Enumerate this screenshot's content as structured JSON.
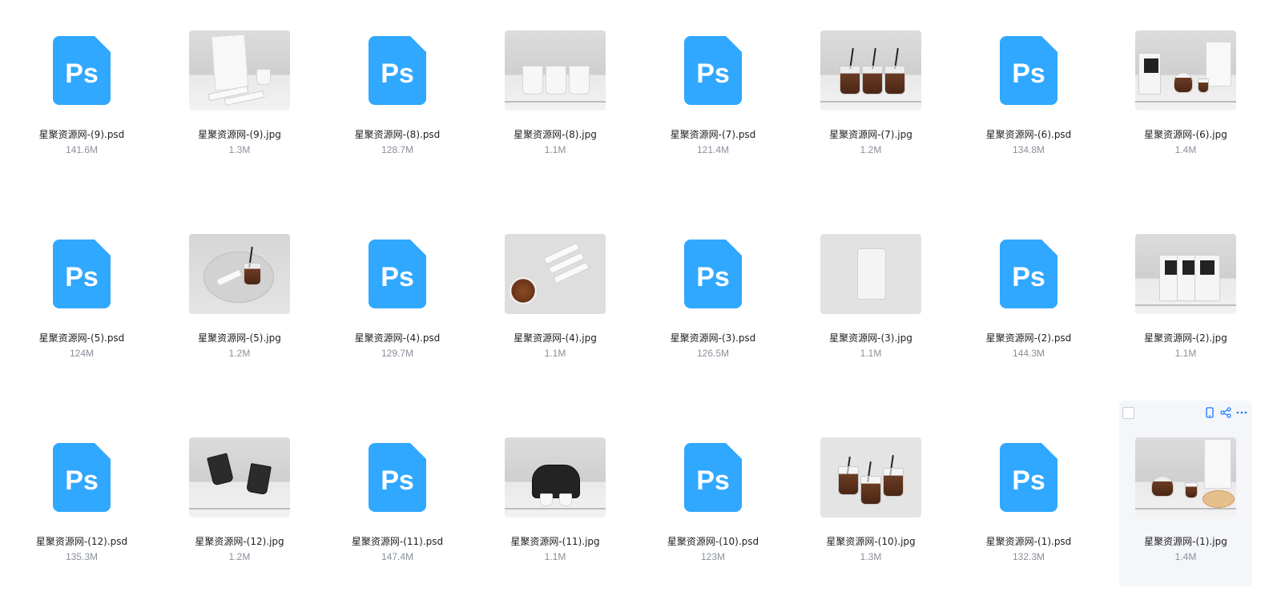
{
  "colors": {
    "ps_icon": "#31a8ff",
    "ps_text": "#ffffff",
    "selected_bg": "#f4f6fa",
    "accent": "#1677ff",
    "size_text": "#8a8f99"
  },
  "files": [
    {
      "name": "星聚资源网-(9).psd",
      "size": "141.6M",
      "kind": "psd",
      "icon": "photoshop-icon"
    },
    {
      "name": "星聚资源网-(9).jpg",
      "size": "1.3M",
      "kind": "jpg",
      "preview": "coffee-card-mockup"
    },
    {
      "name": "星聚资源网-(8).psd",
      "size": "128.7M",
      "kind": "psd",
      "icon": "photoshop-icon"
    },
    {
      "name": "星聚资源网-(8).jpg",
      "size": "1.1M",
      "kind": "jpg",
      "preview": "three-paper-cups"
    },
    {
      "name": "星聚资源网-(7).psd",
      "size": "121.4M",
      "kind": "psd",
      "icon": "photoshop-icon"
    },
    {
      "name": "星聚资源网-(7).jpg",
      "size": "1.2M",
      "kind": "jpg",
      "preview": "three-iced-cups"
    },
    {
      "name": "星聚资源网-(6).psd",
      "size": "134.8M",
      "kind": "psd",
      "icon": "photoshop-icon"
    },
    {
      "name": "星聚资源网-(6).jpg",
      "size": "1.4M",
      "kind": "jpg",
      "preview": "coffee-set-mockup"
    },
    {
      "name": "星聚资源网-(5).psd",
      "size": "124M",
      "kind": "psd",
      "icon": "photoshop-icon"
    },
    {
      "name": "星聚资源网-(5).jpg",
      "size": "1.2M",
      "kind": "jpg",
      "preview": "tray-iced-cup"
    },
    {
      "name": "星聚资源网-(4).psd",
      "size": "129.7M",
      "kind": "psd",
      "icon": "photoshop-icon"
    },
    {
      "name": "星聚资源网-(4).jpg",
      "size": "1.1M",
      "kind": "jpg",
      "preview": "sugar-sticks-cup"
    },
    {
      "name": "星聚资源网-(3).psd",
      "size": "126.5M",
      "kind": "psd",
      "icon": "photoshop-icon"
    },
    {
      "name": "星聚资源网-(3).jpg",
      "size": "1.1M",
      "kind": "jpg",
      "preview": "coffee-pouch"
    },
    {
      "name": "星聚资源网-(2).psd",
      "size": "144.3M",
      "kind": "psd",
      "icon": "photoshop-icon"
    },
    {
      "name": "星聚资源网-(2).jpg",
      "size": "1.1M",
      "kind": "jpg",
      "preview": "three-coffee-bags"
    },
    {
      "name": "星聚资源网-(12).psd",
      "size": "135.3M",
      "kind": "psd",
      "icon": "photoshop-icon"
    },
    {
      "name": "星聚资源网-(12).jpg",
      "size": "1.2M",
      "kind": "jpg",
      "preview": "two-dark-cups"
    },
    {
      "name": "星聚资源网-(11).psd",
      "size": "147.4M",
      "kind": "psd",
      "icon": "photoshop-icon"
    },
    {
      "name": "星聚资源网-(11).jpg",
      "size": "1.1M",
      "kind": "jpg",
      "preview": "cup-carrier"
    },
    {
      "name": "星聚资源网-(10).psd",
      "size": "123M",
      "kind": "psd",
      "icon": "photoshop-icon"
    },
    {
      "name": "星聚资源网-(10).jpg",
      "size": "1.3M",
      "kind": "jpg",
      "preview": "three-iced-cups-top"
    },
    {
      "name": "星聚资源网-(1).psd",
      "size": "132.3M",
      "kind": "psd",
      "icon": "photoshop-icon"
    },
    {
      "name": "星聚资源网-(1).jpg",
      "size": "1.4M",
      "kind": "jpg",
      "preview": "coffee-set-croissant",
      "selected": true
    }
  ],
  "hover_actions": [
    "phone-icon",
    "share-icon",
    "more-icon"
  ]
}
